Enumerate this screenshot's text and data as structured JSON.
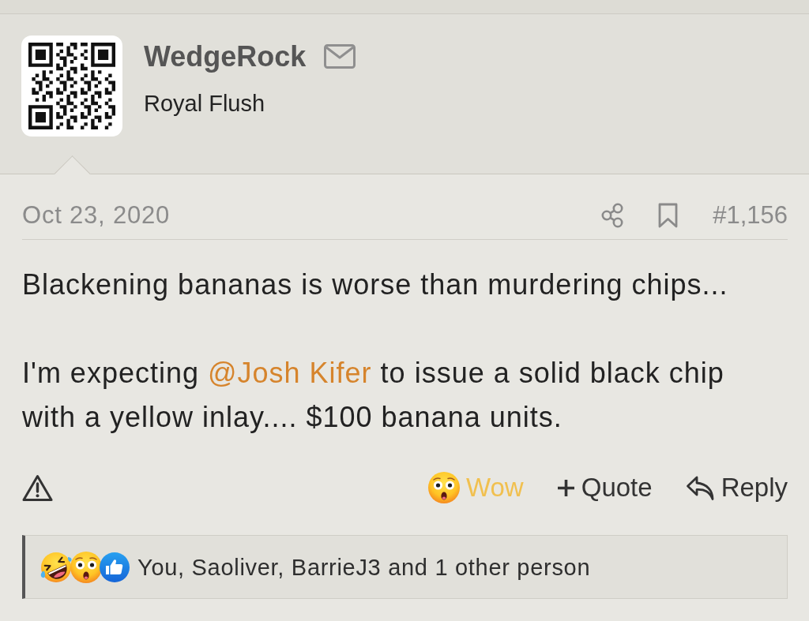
{
  "header": {
    "username": "WedgeRock",
    "user_title": "Royal Flush"
  },
  "post_meta": {
    "date": "Oct 23, 2020",
    "post_number": "#1,156"
  },
  "body": {
    "paragraphs": [
      {
        "segments": [
          {
            "kind": "text",
            "text": "Blackening bananas is worse than murdering chips..."
          }
        ]
      },
      {
        "segments": [
          {
            "kind": "text",
            "text": "I'm expecting "
          },
          {
            "kind": "mention",
            "text": "@Josh Kifer"
          },
          {
            "kind": "text",
            "text": " to issue a solid black chip with a yellow inlay.... $100 banana units."
          }
        ]
      }
    ]
  },
  "actions": [
    {
      "kind": "reaction",
      "label": "Wow",
      "on": true
    },
    {
      "kind": "quote",
      "label": "Quote"
    },
    {
      "kind": "reply",
      "label": "Reply"
    }
  ],
  "reactions_summary": {
    "text": "You, Saoliver, BarrieJ3 and 1 other person"
  }
}
